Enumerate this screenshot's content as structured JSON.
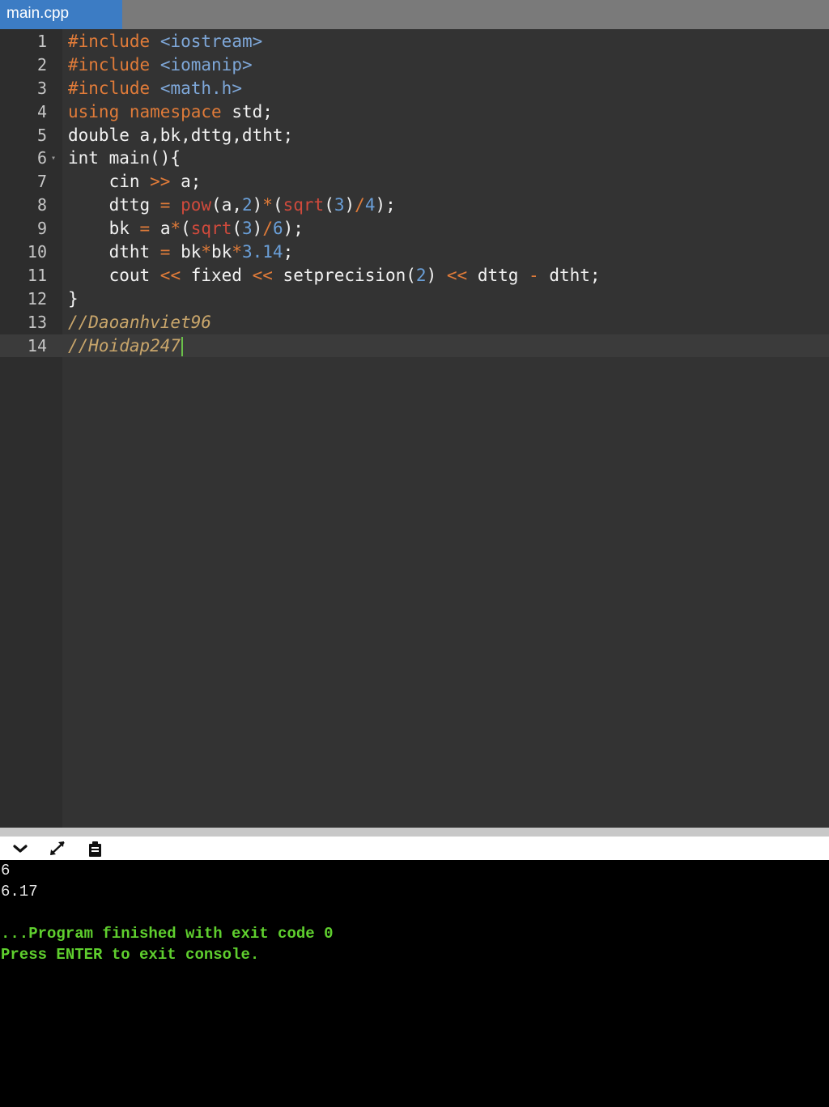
{
  "tabs": [
    {
      "label": "main.cpp",
      "active": true
    }
  ],
  "editor": {
    "lines": [
      {
        "n": "1",
        "html": "<span class=\"kw\">#include</span> <span class=\"inc\">&lt;iostream&gt;</span>"
      },
      {
        "n": "2",
        "html": "<span class=\"kw\">#include</span> <span class=\"inc\">&lt;iomanip&gt;</span>"
      },
      {
        "n": "3",
        "html": "<span class=\"kw\">#include</span> <span class=\"inc\">&lt;math.h&gt;</span>"
      },
      {
        "n": "4",
        "html": "<span class=\"kw\">using</span> <span class=\"kw\">namespace</span> std;"
      },
      {
        "n": "5",
        "html": "double a,bk,dttg,dtht;"
      },
      {
        "n": "6",
        "html": "int main(){",
        "fold": true
      },
      {
        "n": "7",
        "html": "    cin <span class=\"op\">&gt;&gt;</span> a;"
      },
      {
        "n": "8",
        "html": "    dttg <span class=\"op\">=</span> <span class=\"fn\">pow</span>(a,<span class=\"num\">2</span>)<span class=\"op\">*</span>(<span class=\"fn\">sqrt</span>(<span class=\"num\">3</span>)<span class=\"op\">/</span><span class=\"num\">4</span>);"
      },
      {
        "n": "9",
        "html": "    bk <span class=\"op\">=</span> a<span class=\"op\">*</span>(<span class=\"fn\">sqrt</span>(<span class=\"num\">3</span>)<span class=\"op\">/</span><span class=\"num\">6</span>);"
      },
      {
        "n": "10",
        "html": "    dtht <span class=\"op\">=</span> bk<span class=\"op\">*</span>bk<span class=\"op\">*</span><span class=\"num\">3.14</span>;"
      },
      {
        "n": "11",
        "html": "    cout <span class=\"op\">&lt;&lt;</span> fixed <span class=\"op\">&lt;&lt;</span> setprecision(<span class=\"num\">2</span>) <span class=\"op\">&lt;&lt;</span> dttg <span class=\"op\">-</span> dtht;"
      },
      {
        "n": "12",
        "html": "}"
      },
      {
        "n": "13",
        "html": "<span class=\"cm\">//Daoanhviet96</span>"
      },
      {
        "n": "14",
        "html": "<span class=\"cm\">//Hoidap247</span><span class=\"cursor\"></span>",
        "active": true
      }
    ]
  },
  "console_toolbar": {
    "buttons": [
      {
        "name": "collapse-console-button",
        "icon": "chevron-down-icon"
      },
      {
        "name": "expand-console-button",
        "icon": "expand-arrows-icon"
      },
      {
        "name": "copy-output-button",
        "icon": "clipboard-icon"
      }
    ]
  },
  "console": {
    "lines": [
      {
        "text": "6",
        "kind": "out"
      },
      {
        "text": "6.17",
        "kind": "out"
      },
      {
        "text": "",
        "kind": "out"
      },
      {
        "text": "...Program finished with exit code 0",
        "kind": "info"
      },
      {
        "text": "Press ENTER to exit console.",
        "kind": "info"
      }
    ]
  },
  "colors": {
    "tab_active": "#3c7cc4",
    "tabbar": "#7a7a7a",
    "editor_bg": "#333333",
    "gutter_bg": "#2d2d2d",
    "console_bg": "#000000",
    "console_info": "#5fcf2e"
  }
}
